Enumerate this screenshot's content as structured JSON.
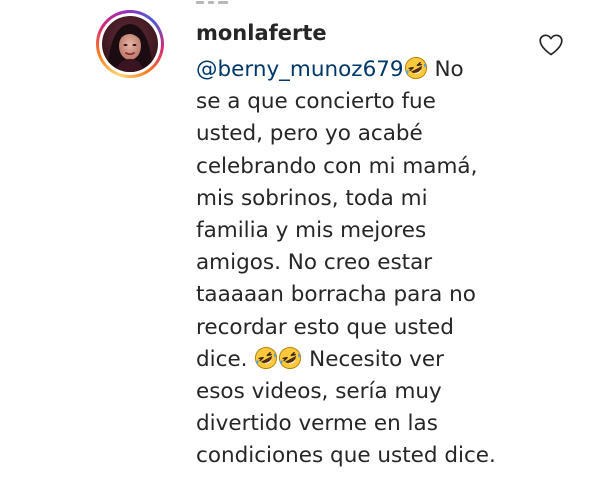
{
  "comment": {
    "username": "monlaferte",
    "mention": "@berny_munoz679",
    "text_lines": [
      [
        "mention",
        "emoji",
        " No"
      ],
      [
        "se a que concierto fue"
      ],
      [
        "usted, pero yo acabé"
      ],
      [
        "celebrando con mi mamá,"
      ],
      [
        "mis sobrinos, toda mi"
      ],
      [
        "familia y mis mejores"
      ],
      [
        "amigos. No creo estar"
      ],
      [
        "taaaaan borracha para no"
      ],
      [
        "recordar esto que usted"
      ],
      [
        "dice. ",
        "emoji",
        "emoji",
        " Necesito ver"
      ],
      [
        "esos videos, sería muy"
      ],
      [
        "divertido verme en las"
      ],
      [
        "condiciones que usted dice."
      ]
    ]
  },
  "icons": {
    "emoji": "rolling-on-floor-laughing-emoji-icon",
    "like": "heart-outline-icon"
  },
  "colors": {
    "text": "#262626",
    "mention": "#00376b",
    "emoji_face": "#ffc83d",
    "heart_stroke": "#262626"
  }
}
